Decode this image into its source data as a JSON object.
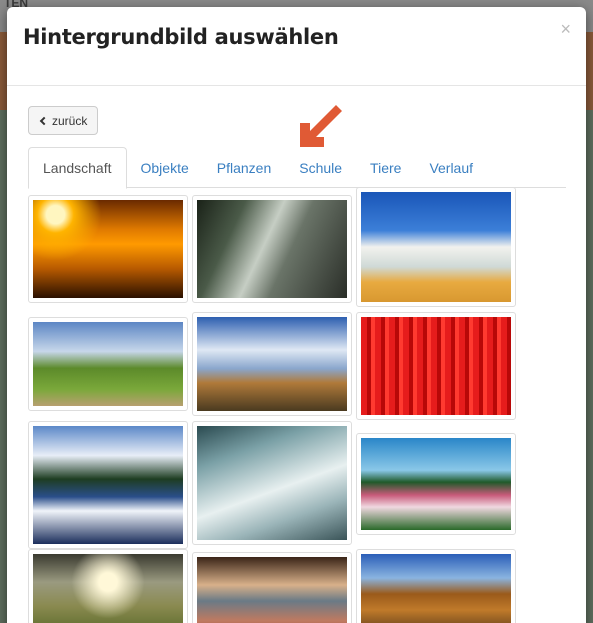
{
  "background": {
    "topbar_text": "TEN"
  },
  "modal": {
    "title": "Hintergrundbild auswählen",
    "close": "×",
    "back_label": "zurück"
  },
  "tabs": [
    "Landschaft",
    "Objekte",
    "Pflanzen",
    "Schule",
    "Tiere",
    "Verlauf"
  ],
  "active_tab": "Landschaft",
  "colors": {
    "accent": "#3a7fc1",
    "arrow": "#e05a35"
  },
  "images": [
    "sunset-clouds",
    "forest-road-sunrays",
    "ocean-waves-beach",
    "country-road-field",
    "field-horizon-clouds",
    "red-tulip-field",
    "mountain-lake-reflection",
    "waterfall-mist",
    "flower-field-trees",
    "stormy-sky-field",
    "beach-starfish-rocks",
    "autumn-hills-lake"
  ]
}
